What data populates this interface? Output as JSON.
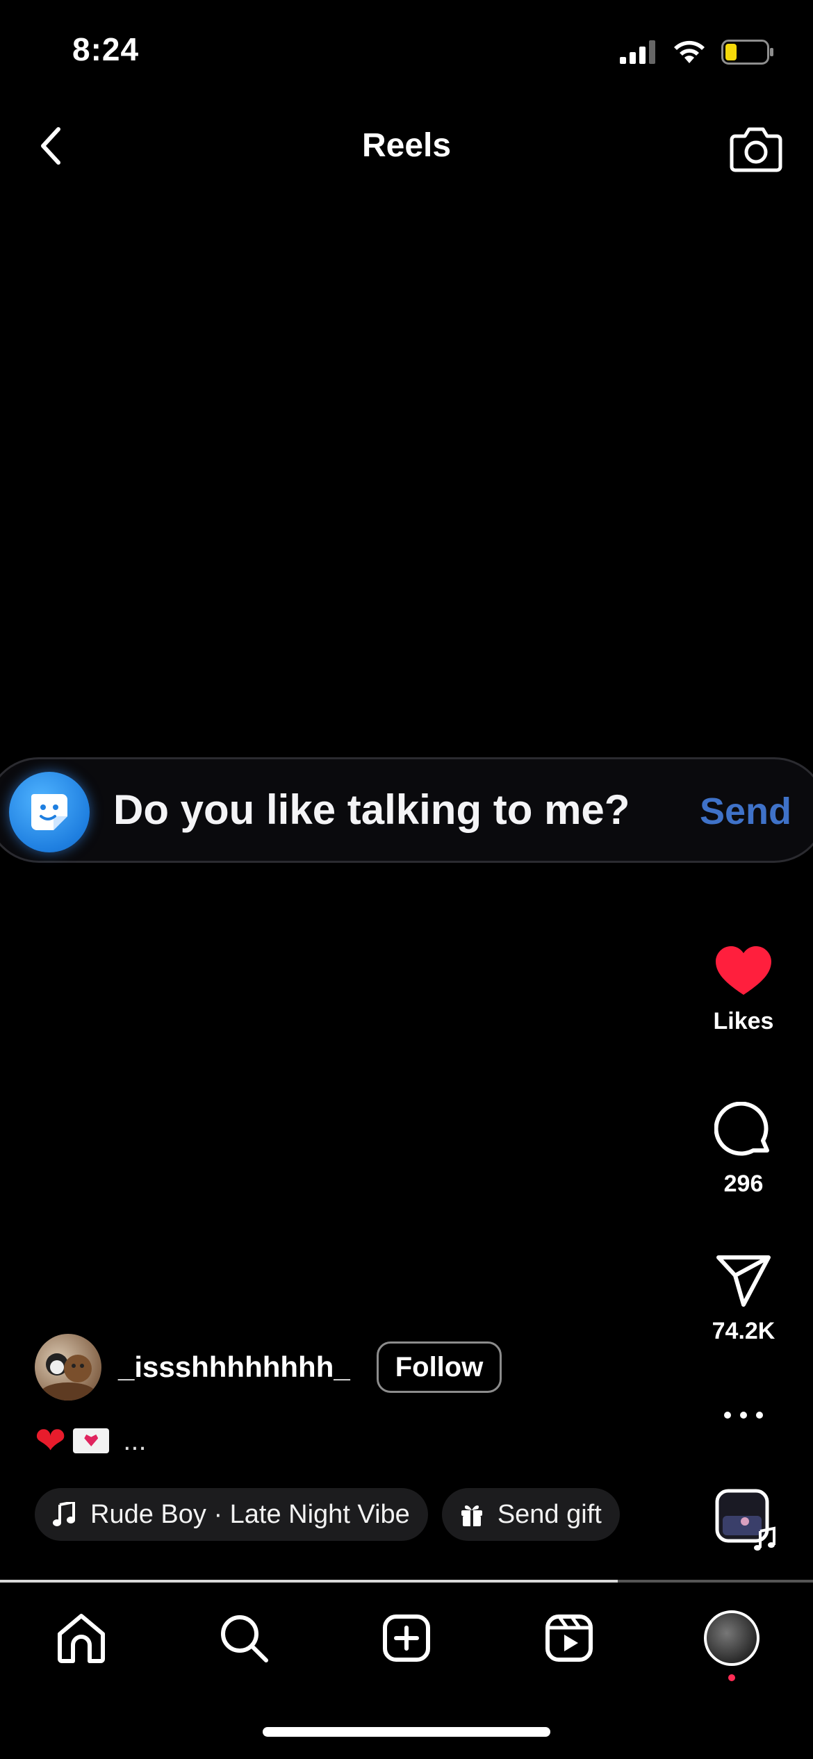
{
  "status": {
    "time": "8:24"
  },
  "header": {
    "title": "Reels"
  },
  "prompt": {
    "text": "Do you like talking to me?",
    "send_label": "Send"
  },
  "rail": {
    "likes_label": "Likes",
    "comments_count": "296",
    "shares_count": "74.2K"
  },
  "author": {
    "username": "_issshhhhhhhh_",
    "follow_label": "Follow"
  },
  "caption": {
    "more": "..."
  },
  "chips": {
    "audio": "Rude Boy · Late Night Vibe",
    "gift": "Send gift"
  },
  "video": {
    "progress_percent": 76
  },
  "icons": {
    "back": "chevron-left-icon",
    "camera": "camera-icon",
    "like": "heart-icon",
    "comment": "comment-icon",
    "share": "paper-plane-icon",
    "more": "more-horizontal-icon",
    "home": "home-icon",
    "search": "search-icon",
    "create": "plus-square-icon",
    "reels": "reels-icon"
  },
  "colors": {
    "like": "#ff1f3d",
    "send": "#3f72c8",
    "prompt_icon": "#1f7fe0",
    "battery": "#f5d90a",
    "notification_dot": "#ff2d55"
  }
}
